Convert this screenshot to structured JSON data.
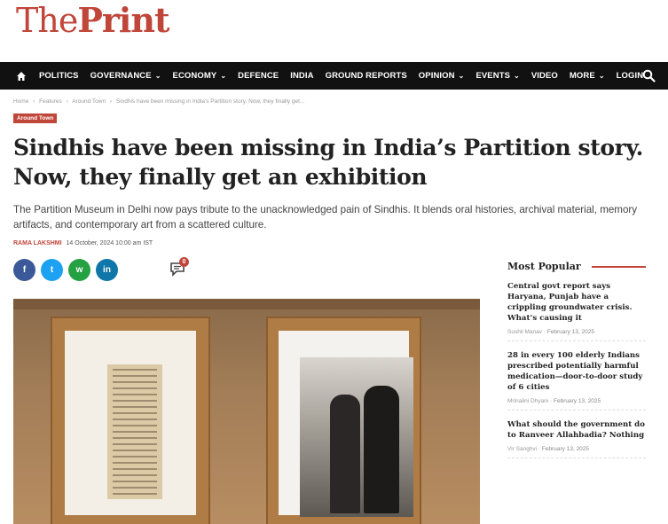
{
  "logo": {
    "part1": "The",
    "part2": "Print"
  },
  "nav": {
    "items": [
      {
        "label": "POLITICS",
        "dropdown": false
      },
      {
        "label": "GOVERNANCE",
        "dropdown": true
      },
      {
        "label": "ECONOMY",
        "dropdown": true
      },
      {
        "label": "DEFENCE",
        "dropdown": false
      },
      {
        "label": "INDIA",
        "dropdown": false
      },
      {
        "label": "GROUND REPORTS",
        "dropdown": false
      },
      {
        "label": "OPINION",
        "dropdown": true
      },
      {
        "label": "EVENTS",
        "dropdown": true
      },
      {
        "label": "VIDEO",
        "dropdown": false
      },
      {
        "label": "MORE",
        "dropdown": true
      },
      {
        "label": "LOGIN",
        "dropdown": false
      }
    ],
    "home_icon": "home-icon",
    "search_icon": "search-icon"
  },
  "breadcrumb": {
    "items": [
      "Home",
      "›",
      "Features",
      "›",
      "Around Town",
      "›",
      "Sindhis have been missing in India's Partition story. Now, they finally get..."
    ]
  },
  "article": {
    "tag": "Around Town",
    "headline": "Sindhis have been missing in India’s Partition story. Now, they finally get an exhibition",
    "dek": "The Partition Museum in Delhi now pays tribute to the unacknowledged pain of Sindhis. It blends oral histories, archival material, memory artifacts, and contemporary art from a scattered culture.",
    "author": "RAMA LAKSHMI",
    "date": "14 October, 2024 10:00 am IST",
    "comment_count": "0"
  },
  "social": {
    "facebook": "f",
    "twitter": "t",
    "whatsapp": "w",
    "linkedin": "in"
  },
  "sidebar": {
    "title": "Most Popular",
    "items": [
      {
        "title": "Central govt report says Haryana, Punjab have a crippling groundwater crisis. What’s causing it",
        "author": "Sushil Manav",
        "date": "February 13, 2025"
      },
      {
        "title": "28 in every 100 elderly Indians prescribed potentially harmful medication—door-to-door study of 6 cities",
        "author": "Mrinalini Dhyani",
        "date": "February 13, 2025"
      },
      {
        "title": "What should the government do to Ranveer Allahbadia? Nothing",
        "author": "Vir Sanghvi",
        "date": "February 13, 2025"
      }
    ]
  },
  "colors": {
    "brand": "#c0463a",
    "nav_bg": "#111111"
  }
}
